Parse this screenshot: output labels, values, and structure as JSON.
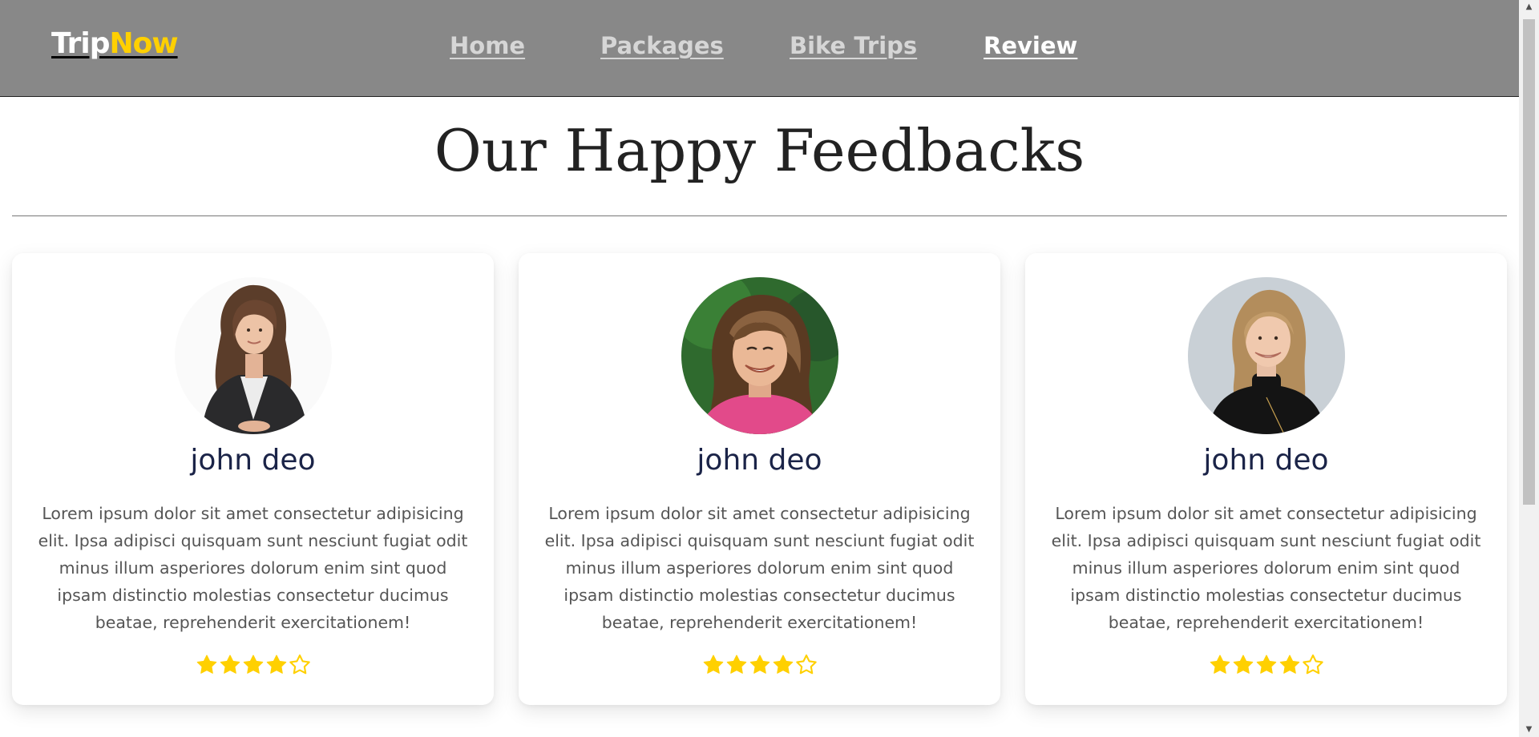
{
  "nav": {
    "logo_part1": "Trip",
    "logo_part2": "Now",
    "links": [
      {
        "label": "Home",
        "active": false
      },
      {
        "label": "Packages",
        "active": false
      },
      {
        "label": "Bike Trips",
        "active": false
      },
      {
        "label": "Review",
        "active": true
      }
    ]
  },
  "section": {
    "title": "Our Happy Feedbacks"
  },
  "reviews": [
    {
      "name": "john deo",
      "text": "Lorem ipsum dolor sit amet consectetur adipisicing elit. Ipsa adipisci quisquam sunt nesciunt fugiat odit minus illum asperiores dolorum enim sint quod ipsam distinctio molestias consectetur ducimus beatae, reprehenderit exercitationem!",
      "rating": 4,
      "max_rating": 5,
      "avatar_icon": "woman-leather-jacket-photo"
    },
    {
      "name": "john deo",
      "text": "Lorem ipsum dolor sit amet consectetur adipisicing elit. Ipsa adipisci quisquam sunt nesciunt fugiat odit minus illum asperiores dolorum enim sint quod ipsam distinctio molestias consectetur ducimus beatae, reprehenderit exercitationem!",
      "rating": 4,
      "max_rating": 5,
      "avatar_icon": "smiling-woman-pink-top-photo"
    },
    {
      "name": "john deo",
      "text": "Lorem ipsum dolor sit amet consectetur adipisicing elit. Ipsa adipisci quisquam sunt nesciunt fugiat odit minus illum asperiores dolorum enim sint quod ipsam distinctio molestias consectetur ducimus beatae, reprehenderit exercitationem!",
      "rating": 4,
      "max_rating": 5,
      "avatar_icon": "blonde-woman-black-sweater-photo"
    }
  ],
  "colors": {
    "navbar_bg": "#888888",
    "accent_yellow": "#ffd000",
    "name_color": "#1b2448",
    "text_color": "#555555"
  }
}
